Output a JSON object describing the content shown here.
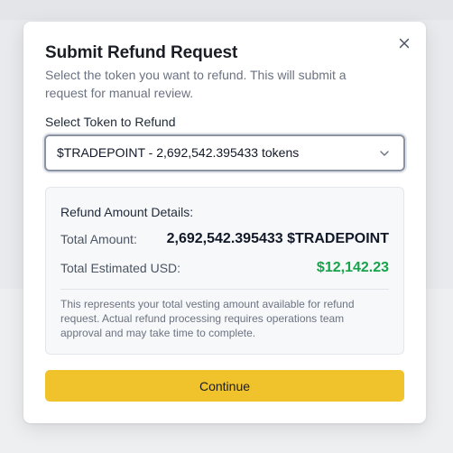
{
  "modal": {
    "title": "Submit Refund Request",
    "description": "Select the token you want to refund. This will submit a request for manual review.",
    "close_icon": "close-icon"
  },
  "token_select": {
    "label": "Select Token to Refund",
    "selected_value": "$TRADEPOINT - 2,692,542.395433 tokens",
    "chevron_icon": "chevron-down-icon"
  },
  "details": {
    "heading": "Refund Amount Details:",
    "total_amount_label": "Total Amount:",
    "total_amount_value": "2,692,542.395433 $TRADEPOINT",
    "total_usd_label": "Total Estimated USD:",
    "total_usd_value": "$12,142.23",
    "note": "This represents your total vesting amount available for refund request. Actual refund processing requires operations team approval and may take time to complete."
  },
  "actions": {
    "continue_label": "Continue"
  },
  "colors": {
    "accent_button": "#f0c22c",
    "usd_green": "#16a34a",
    "select_border": "#8a93a3"
  }
}
